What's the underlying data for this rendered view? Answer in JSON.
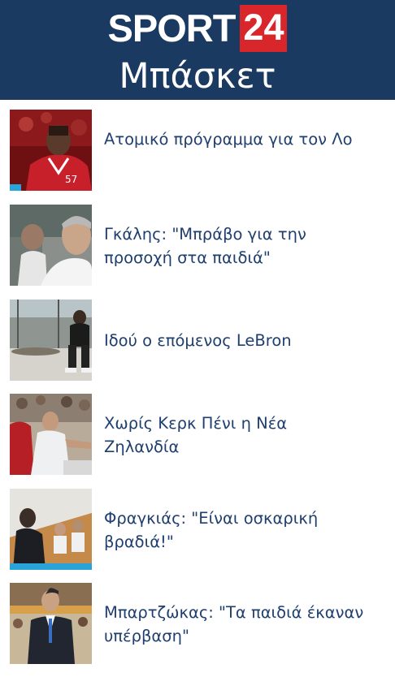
{
  "header": {
    "logo_text": "SPORT",
    "logo_number": "24",
    "section_title": "Μπάσκετ"
  },
  "articles": [
    {
      "title": "Ατομικό πρόγραμμα για τον Λο"
    },
    {
      "title": "Γκάλης: \"Μπράβο για την προσοχή στα παιδιά\""
    },
    {
      "title": "Ιδού ο επόμενος LeBron"
    },
    {
      "title": "Χωρίς Κερκ Πένι η Νέα Ζηλανδία"
    },
    {
      "title": "Φραγκιάς: \"Είναι οσκαρική βραδιά!\""
    },
    {
      "title": "Μπαρτζώκας: \"Τα παιδιά έκαναν υπέρβαση\""
    }
  ],
  "colors": {
    "header_bg": "#1b3a62",
    "logo_badge": "#d9262b",
    "title_text": "#1f3f6e"
  }
}
